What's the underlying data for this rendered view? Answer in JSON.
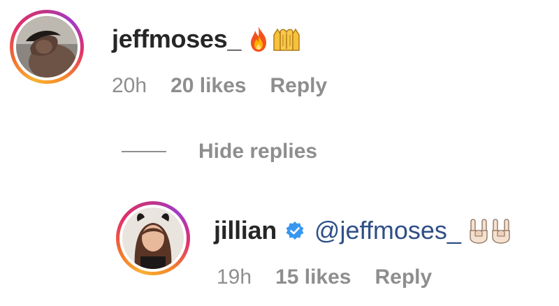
{
  "comment": {
    "username": "jeffmoses_",
    "emojis": [
      "fire-emoji",
      "raising-hands-emoji"
    ],
    "time": "20h",
    "likes": "20 likes",
    "reply": "Reply"
  },
  "hide_replies": {
    "label": "Hide replies"
  },
  "reply_item": {
    "username": "jillian",
    "verified_icon": "verified-badge-icon",
    "mention": "@jeffmoses_",
    "emojis": [
      "sign-of-horns-emoji",
      "sign-of-horns-emoji"
    ],
    "time": "19h",
    "likes": "15 likes",
    "reply": "Reply"
  },
  "colors": {
    "text_primary": "#262626",
    "text_secondary": "#8e8e8e",
    "mention": "#2f4f86",
    "verified": "#3897f0"
  }
}
